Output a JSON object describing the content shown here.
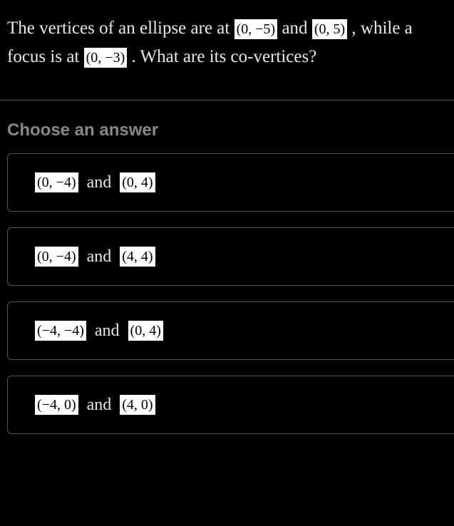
{
  "question": {
    "text_parts": {
      "p1": "The vertices of an ellipse are at ",
      "p2": " and ",
      "p3": " , while a focus is at ",
      "p4": " . What are its co-vertices?"
    },
    "math": {
      "vertex1": "(0, −5)",
      "vertex2": "(0, 5)",
      "focus": "(0, −3)"
    }
  },
  "choose_label": "Choose an answer",
  "and_connector": "and",
  "answers": [
    {
      "pair1": "(0, −4)",
      "pair2": "(0, 4)"
    },
    {
      "pair1": "(0, −4)",
      "pair2": "(4, 4)"
    },
    {
      "pair1": "(−4, −4)",
      "pair2": "(0, 4)"
    },
    {
      "pair1": "(−4, 0)",
      "pair2": "(4, 0)"
    }
  ]
}
